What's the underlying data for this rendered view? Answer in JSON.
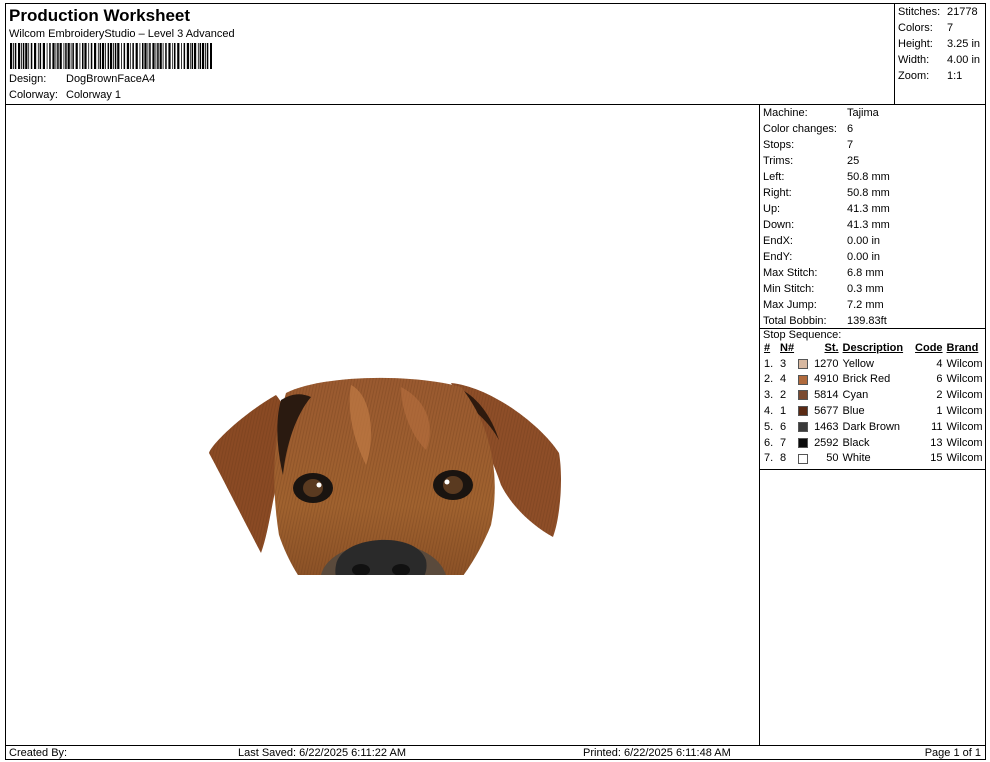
{
  "header": {
    "title": "Production Worksheet",
    "software": "Wilcom EmbroideryStudio – Level 3 Advanced",
    "design_label": "Design:",
    "design_value": "DogBrownFaceA4",
    "colorway_label": "Colorway:",
    "colorway_value": "Colorway 1"
  },
  "summary": [
    {
      "label": "Stitches:",
      "value": "21778"
    },
    {
      "label": "Colors:",
      "value": "7"
    },
    {
      "label": "Height:",
      "value": "3.25 in"
    },
    {
      "label": "Width:",
      "value": "4.00 in"
    },
    {
      "label": "Zoom:",
      "value": "1:1"
    }
  ],
  "machine_info": [
    {
      "label": "Machine:",
      "value": "Tajima"
    },
    {
      "label": "Color changes:",
      "value": "6"
    },
    {
      "label": "Stops:",
      "value": "7"
    },
    {
      "label": "Trims:",
      "value": "25"
    },
    {
      "label": "Left:",
      "value": "50.8 mm"
    },
    {
      "label": "Right:",
      "value": "50.8 mm"
    },
    {
      "label": "Up:",
      "value": "41.3 mm"
    },
    {
      "label": "Down:",
      "value": "41.3 mm"
    },
    {
      "label": "EndX:",
      "value": "0.00 in"
    },
    {
      "label": "EndY:",
      "value": "0.00 in"
    },
    {
      "label": "Max Stitch:",
      "value": "6.8 mm"
    },
    {
      "label": "Min Stitch:",
      "value": "0.3 mm"
    },
    {
      "label": "Max Jump:",
      "value": "7.2 mm"
    },
    {
      "label": "Total Bobbin:",
      "value": "139.83ft"
    }
  ],
  "stop_sequence": {
    "title": "Stop Sequence:",
    "columns": {
      "num": "#",
      "n": "N#",
      "st": "St.",
      "description": "Description",
      "code": "Code",
      "brand": "Brand"
    },
    "rows": [
      {
        "num": "1.",
        "n": "3",
        "color": "#d8b8a0",
        "st": "1270",
        "description": "Yellow",
        "code": "4",
        "brand": "Wilcom"
      },
      {
        "num": "2.",
        "n": "4",
        "color": "#b06a3c",
        "st": "4910",
        "description": "Brick Red",
        "code": "6",
        "brand": "Wilcom"
      },
      {
        "num": "3.",
        "n": "2",
        "color": "#7a4a30",
        "st": "5814",
        "description": "Cyan",
        "code": "2",
        "brand": "Wilcom"
      },
      {
        "num": "4.",
        "n": "1",
        "color": "#5a2a14",
        "st": "5677",
        "description": "Blue",
        "code": "1",
        "brand": "Wilcom"
      },
      {
        "num": "5.",
        "n": "6",
        "color": "#3a3a3a",
        "st": "1463",
        "description": "Dark Brown",
        "code": "11",
        "brand": "Wilcom"
      },
      {
        "num": "6.",
        "n": "7",
        "color": "#0a0a0a",
        "st": "2592",
        "description": "Black",
        "code": "13",
        "brand": "Wilcom"
      },
      {
        "num": "7.",
        "n": "8",
        "color": "#ffffff",
        "st": "50",
        "description": "White",
        "code": "15",
        "brand": "Wilcom"
      }
    ]
  },
  "footer": {
    "created_by": "Created By:",
    "last_saved": "Last Saved: 6/22/2025 6:11:22 AM",
    "printed": "Printed: 6/22/2025 6:11:48 AM",
    "page": "Page 1 of 1"
  }
}
